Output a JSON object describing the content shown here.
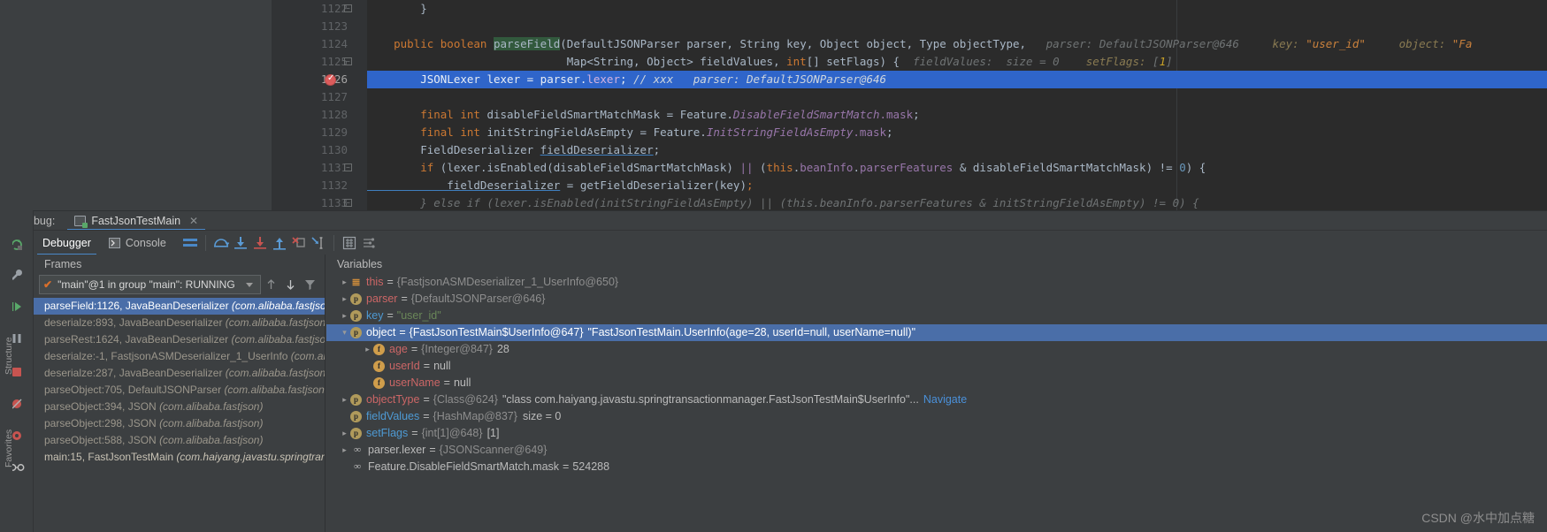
{
  "editor": {
    "lines": [
      {
        "num": "1122",
        "fold": "minus",
        "bp": false
      },
      {
        "num": "1123",
        "fold": null,
        "bp": false
      },
      {
        "num": "1124",
        "fold": null,
        "bp": false
      },
      {
        "num": "1125",
        "fold": "minus",
        "bp": false
      },
      {
        "num": "1126",
        "fold": null,
        "bp": true
      },
      {
        "num": "1127",
        "fold": null,
        "bp": false
      },
      {
        "num": "1128",
        "fold": null,
        "bp": false
      },
      {
        "num": "1129",
        "fold": null,
        "bp": false
      },
      {
        "num": "1130",
        "fold": null,
        "bp": false
      },
      {
        "num": "1131",
        "fold": "minus",
        "bp": false
      },
      {
        "num": "1132",
        "fold": null,
        "bp": false
      },
      {
        "num": "1133",
        "fold": "minus",
        "bp": false
      }
    ],
    "code": {
      "l1122": "}",
      "l1124_sig": "public boolean parseField(DefaultJSONParser parser, String key, Object object, Type objectType,",
      "l1124_hint_parser": "parser:  DefaultJSONParser@646",
      "l1124_hint_key_label": "key:",
      "l1124_hint_key_val": "\"user_id\"",
      "l1124_hint_object_label": "object:",
      "l1124_hint_object_val": "\"Fa",
      "l1125_sig": "Map<String, Object> fieldValues, int[] setFlags) {",
      "l1125_hint_fieldvalues": "fieldValues:  size = 0",
      "l1125_hint_setflags_label": "setFlags:",
      "l1125_hint_setflags_val": "[1]",
      "l1126_code": "JSONLexer lexer = parser.lexer;",
      "l1126_comment": "// xxx",
      "l1126_hint": "parser:  DefaultJSONParser@646",
      "l1128": "final int disableFieldSmartMatchMask = Feature.DisableFieldSmartMatch.mask;",
      "l1129": "final int initStringFieldAsEmpty = Feature.InitStringFieldAsEmpty.mask;",
      "l1130": "FieldDeserializer fieldDeserializer;",
      "l1131": "if (lexer.isEnabled(disableFieldSmartMatchMask) || (this.beanInfo.parserFeatures & disableFieldSmartMatchMask) != 0) {",
      "l1132": "fieldDeserializer = getFieldDeserializer(key);",
      "l1133": "} else if (lexer.isEnabled(initStringFieldAsEmpty) || (this.beanInfo.parserFeatures & initStringFieldAsEmpty) != 0) {"
    }
  },
  "debug_window": {
    "label": "Debug:",
    "tab_name": "FastJsonTestMain",
    "tab_close": "✕",
    "toolbar": {
      "tabs": [
        {
          "label": "Debugger",
          "icon": null,
          "selected": true
        },
        {
          "label": "Console",
          "icon": "console-icon",
          "selected": false
        }
      ],
      "icons": [
        "layout-icon",
        "step-over-icon",
        "step-into-icon",
        "force-step-into-icon",
        "step-out-icon",
        "drop-frame-icon",
        "run-to-cursor-icon",
        "evaluate-icon",
        "settings-icon"
      ]
    },
    "left_strip_icons": [
      "rerun-icon",
      "settings-wrench-icon",
      "resume-icon",
      "pause-icon",
      "stop-icon",
      "mute-breakpoints-icon",
      "view-breakpoints-icon",
      "glasses-icon"
    ],
    "rail_labels": [
      "Structure",
      "Favorites"
    ]
  },
  "frames": {
    "header": "Frames",
    "thread": "\"main\"@1 in group \"main\": RUNNING",
    "thread_check": "✔",
    "toolbar_icons": [
      "arrow-up-icon",
      "arrow-down-icon",
      "filter-icon",
      "plus-icon"
    ],
    "items": [
      {
        "text": "parseField:1126, JavaBeanDeserializer ",
        "pkg": "(com.alibaba.fastjson.",
        "selected": true,
        "own": false
      },
      {
        "text": "deserialze:893, JavaBeanDeserializer ",
        "pkg": "(com.alibaba.fastjson.p",
        "selected": false,
        "own": false
      },
      {
        "text": "parseRest:1624, JavaBeanDeserializer ",
        "pkg": "(com.alibaba.fastjson.p",
        "selected": false,
        "own": false
      },
      {
        "text": "deserialze:-1, FastjsonASMDeserializer_1_UserInfo ",
        "pkg": "(com.aliba",
        "selected": false,
        "own": false
      },
      {
        "text": "deserialze:287, JavaBeanDeserializer ",
        "pkg": "(com.alibaba.fastjson.p",
        "selected": false,
        "own": false
      },
      {
        "text": "parseObject:705, DefaultJSONParser ",
        "pkg": "(com.alibaba.fastjson.p",
        "selected": false,
        "own": false
      },
      {
        "text": "parseObject:394, JSON ",
        "pkg": "(com.alibaba.fastjson)",
        "selected": false,
        "own": false
      },
      {
        "text": "parseObject:298, JSON ",
        "pkg": "(com.alibaba.fastjson)",
        "selected": false,
        "own": false
      },
      {
        "text": "parseObject:588, JSON ",
        "pkg": "(com.alibaba.fastjson)",
        "selected": false,
        "own": false
      },
      {
        "text": "main:15, FastJsonTestMain ",
        "pkg": "(com.haiyang.javastu.springtransa",
        "selected": false,
        "own": true
      }
    ]
  },
  "variables": {
    "header": "Variables",
    "gutter_icons": [
      "filter-icon",
      "plus-icon",
      "minus-icon",
      "up-icon",
      "down-icon",
      "copy-icon",
      "oo-icon"
    ],
    "rows": [
      {
        "arrow": "▸",
        "icon": "lines",
        "icon_char": "≣",
        "name": "this",
        "name_color": "red",
        "eq": "=",
        "ref": "{FastjsonASMDeserializer_1_UserInfo@650}",
        "val": "",
        "indent": 0,
        "selected": false
      },
      {
        "arrow": "▸",
        "icon": "p",
        "icon_char": "p",
        "name": "parser",
        "name_color": "red",
        "eq": "=",
        "ref": "{DefaultJSONParser@646}",
        "val": "",
        "indent": 0,
        "selected": false
      },
      {
        "arrow": "▸",
        "icon": "p",
        "icon_char": "p",
        "name": "key",
        "name_color": "blue",
        "eq": "=",
        "ref": "",
        "val": "\"user_id\"",
        "val_kind": "string",
        "indent": 0,
        "selected": false
      },
      {
        "arrow": "▾",
        "icon": "p",
        "icon_char": "p",
        "name": "object",
        "name_color": "red",
        "eq": "=",
        "ref": "{FastJsonTestMain$UserInfo@647}",
        "val": "\"FastJsonTestMain.UserInfo(age=28, userId=null, userName=null)\"",
        "indent": 0,
        "selected": true
      },
      {
        "arrow": "▸",
        "icon": "f",
        "icon_char": "f",
        "name": "age",
        "name_color": "red",
        "eq": "=",
        "ref": "{Integer@847}",
        "val": "28",
        "indent": 1,
        "selected": false
      },
      {
        "arrow": "",
        "icon": "f",
        "icon_char": "f",
        "name": "userId",
        "name_color": "red",
        "eq": "=",
        "ref": "",
        "val": "null",
        "indent": 1,
        "selected": false
      },
      {
        "arrow": "",
        "icon": "f",
        "icon_char": "f",
        "name": "userName",
        "name_color": "red",
        "eq": "=",
        "ref": "",
        "val": "null",
        "indent": 1,
        "selected": false
      },
      {
        "arrow": "▸",
        "icon": "p",
        "icon_char": "p",
        "name": "objectType",
        "name_color": "red",
        "eq": "=",
        "ref": "{Class@624}",
        "val": "\"class com.haiyang.javastu.springtransactionmanager.FastJsonTestMain$UserInfo\"...",
        "link": "Navigate",
        "indent": 0,
        "selected": false
      },
      {
        "arrow": "",
        "icon": "p",
        "icon_char": "p",
        "name": "fieldValues",
        "name_color": "blue",
        "eq": "=",
        "ref": "{HashMap@837}",
        "val": "size = 0",
        "indent": 0,
        "selected": false
      },
      {
        "arrow": "▸",
        "icon": "p",
        "icon_char": "p",
        "name": "setFlags",
        "name_color": "blue",
        "eq": "=",
        "ref": "{int[1]@648}",
        "val": "[1]",
        "indent": 0,
        "selected": false
      },
      {
        "arrow": "▸",
        "icon": "oo",
        "icon_char": "∞",
        "name": "parser.lexer",
        "name_color": "plain",
        "eq": "=",
        "ref": "{JSONScanner@649}",
        "val": "",
        "indent": 0,
        "selected": false
      },
      {
        "arrow": "",
        "icon": "oo",
        "icon_char": "∞",
        "name": "Feature.DisableFieldSmartMatch.mask",
        "name_color": "plain",
        "eq": "=",
        "ref": "",
        "val": "524288",
        "indent": 0,
        "selected": false
      }
    ]
  },
  "watermark": "CSDN @水中加点糖",
  "colors": {
    "editor_bg": "#2b2b2b",
    "gutter_bg": "#313335",
    "panel_bg": "#3c3f41",
    "accent": "#4a88c7",
    "selection": "#4a6ea8",
    "code_highlight": "#2f65ca"
  }
}
